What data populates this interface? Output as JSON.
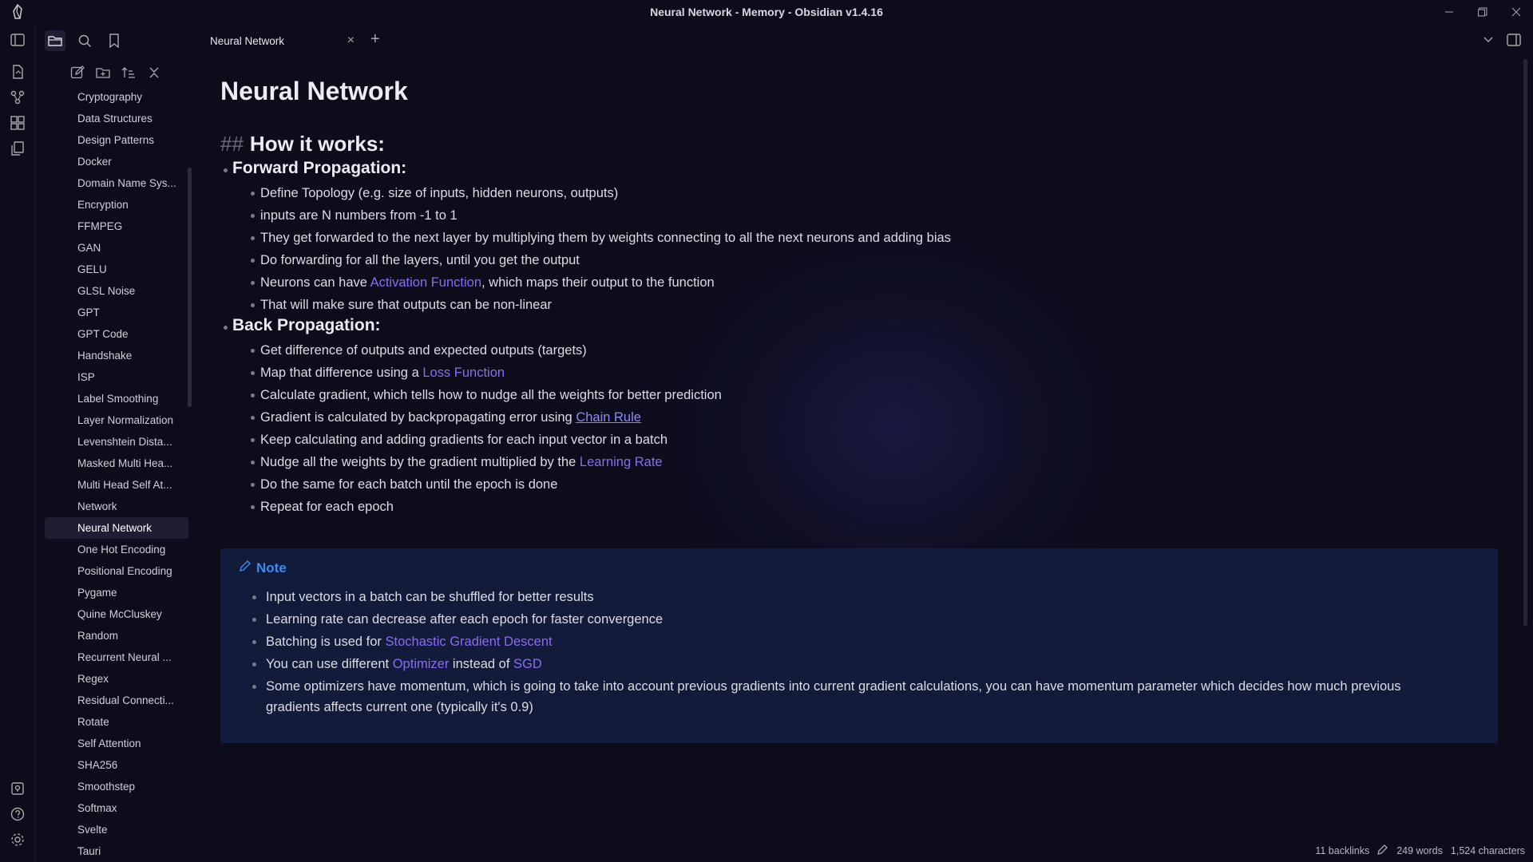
{
  "window": {
    "title": "Neural Network - Memory - Obsidian v1.4.16",
    "controls": [
      "minimize",
      "maximize",
      "close"
    ]
  },
  "ribbon_icons": [
    "sidebar-toggle-icon",
    "open-quick-switcher-icon",
    "graph-view-icon",
    "canvas-icon",
    "templates-icon",
    "vault-icon",
    "help-icon",
    "settings-icon"
  ],
  "top_icons": [
    "folder-icon",
    "search-icon",
    "bookmark-icon"
  ],
  "sidebar": {
    "nav_buttons": [
      "new-note-icon",
      "new-folder-icon",
      "sort-icon",
      "collapse-all-icon"
    ],
    "files": [
      "Cryptography",
      "Data Structures",
      "Design Patterns",
      "Docker",
      "Domain Name Sys...",
      "Encryption",
      "FFMPEG",
      "GAN",
      "GELU",
      "GLSL Noise",
      "GPT",
      "GPT Code",
      "Handshake",
      "ISP",
      "Label Smoothing",
      "Layer Normalization",
      "Levenshtein Dista...",
      "Masked Multi Hea...",
      "Multi Head Self At...",
      "Network",
      "Neural Network",
      "One Hot Encoding",
      "Positional Encoding",
      "Pygame",
      "Quine McCluskey",
      "Random",
      "Recurrent Neural ...",
      "Regex",
      "Residual Connecti...",
      "Rotate",
      "Self Attention",
      "SHA256",
      "Smoothstep",
      "Softmax",
      "Svelte",
      "Tauri"
    ],
    "active_file": "Neural Network"
  },
  "tab": {
    "label": "Neural Network",
    "close": "×",
    "new": "+"
  },
  "note": {
    "title": "Neural Network",
    "h2_hash": "##",
    "h2": "How it works:",
    "sections": [
      {
        "heading": "Forward Propagation:",
        "items": [
          [
            {
              "t": "Define Topology (e.g. size of inputs, hidden neurons, outputs)"
            }
          ],
          [
            {
              "t": "inputs are N numbers from -1 to 1"
            }
          ],
          [
            {
              "t": "They get forwarded to the next layer by multiplying them by weights connecting to all the next neurons and adding bias"
            }
          ],
          [
            {
              "t": "Do forwarding for all the layers, until you get the output"
            }
          ],
          [
            {
              "t": "Neurons can have "
            },
            {
              "t": "Activation Function",
              "link": true
            },
            {
              "t": ", which maps their output to the function"
            }
          ],
          [
            {
              "t": "That will make sure that outputs can be non-linear"
            }
          ]
        ]
      },
      {
        "heading": "Back Propagation:",
        "items": [
          [
            {
              "t": "Get difference of outputs and expected outputs (targets)"
            }
          ],
          [
            {
              "t": "Map that difference using a "
            },
            {
              "t": "Loss Function",
              "link": true
            }
          ],
          [
            {
              "t": "Calculate gradient, which tells how to nudge all the weights for better prediction"
            }
          ],
          [
            {
              "t": "Gradient is calculated by backpropagating error using "
            },
            {
              "t": "Chain Rule",
              "ulink": true
            }
          ],
          [
            {
              "t": "Keep calculating and adding gradients for each input vector in a batch"
            }
          ],
          [
            {
              "t": "Nudge all the weights by the gradient multiplied by the "
            },
            {
              "t": "Learning Rate",
              "link": true
            }
          ],
          [
            {
              "t": "Do the same for each batch until the epoch is done"
            }
          ],
          [
            {
              "t": "Repeat for each epoch"
            }
          ]
        ]
      }
    ],
    "callout": {
      "title": "Note",
      "items": [
        [
          {
            "t": "Input vectors in a batch can be shuffled for better results"
          }
        ],
        [
          {
            "t": "Learning rate can decrease after each epoch for faster convergence"
          }
        ],
        [
          {
            "t": "Batching is used for "
          },
          {
            "t": "Stochastic Gradient Descent",
            "link": true
          }
        ],
        [
          {
            "t": "You can use different "
          },
          {
            "t": "Optimizer",
            "link": true
          },
          {
            "t": " instead of "
          },
          {
            "t": "SGD",
            "link": true
          }
        ],
        [
          {
            "t": "Some optimizers have momentum, which is going to take into account previous gradients into current gradient calculations, you can have momentum parameter which decides how much previous gradients affects current one (typically it's 0.9)"
          }
        ]
      ]
    }
  },
  "status": {
    "backlinks": "11 backlinks",
    "words": "249 words",
    "characters": "1,524 characters"
  },
  "colors": {
    "background": "#0d0c1a",
    "link": "#8a6cf0",
    "callout_title": "#3e8cf0",
    "callout_bg": "#142046"
  }
}
